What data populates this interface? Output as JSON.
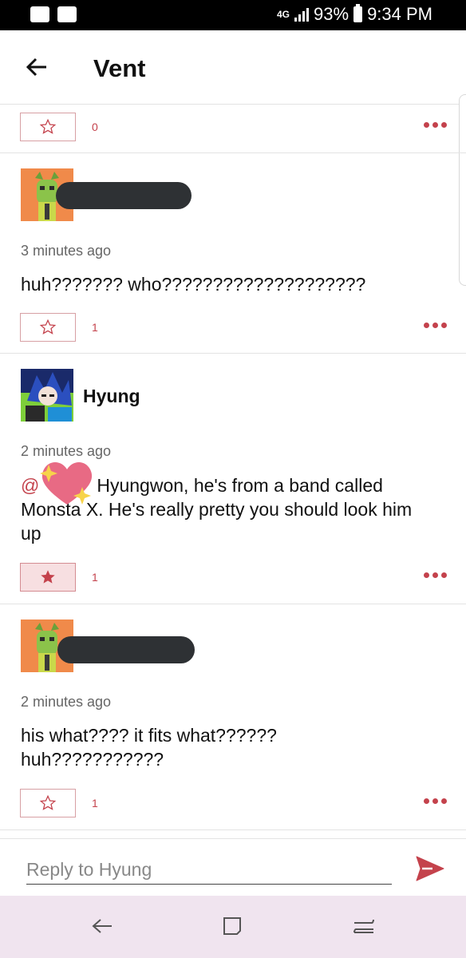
{
  "status_bar": {
    "network": "4G",
    "battery": "93%",
    "time": "9:34 PM"
  },
  "header": {
    "title": "Vent"
  },
  "top_actions": {
    "count": "0"
  },
  "posts": [
    {
      "username": "",
      "time": "3 minutes ago",
      "text": "huh??????? who????????????????????",
      "count": "1",
      "starred": false
    },
    {
      "username": "Hyung",
      "time": "2 minutes ago",
      "mention": "@",
      "text": "Hyungwon, he's from a band called Monsta X. He's really pretty you should look him up",
      "count": "1",
      "starred": true
    },
    {
      "username": "",
      "time": "2 minutes ago",
      "text": "his what???? it fits what?????? huh???????????",
      "count": "1",
      "starred": false
    }
  ],
  "reply": {
    "placeholder": "Reply to Hyung"
  },
  "colors": {
    "accent": "#c4424c",
    "nav_bg": "#f0e4ef"
  },
  "icons": [
    "message-icon",
    "image-icon",
    "back-arrow-icon",
    "star-outline-icon",
    "star-filled-icon",
    "more-icon",
    "send-icon",
    "nav-back-icon",
    "nav-recents-icon",
    "nav-home-icon"
  ]
}
